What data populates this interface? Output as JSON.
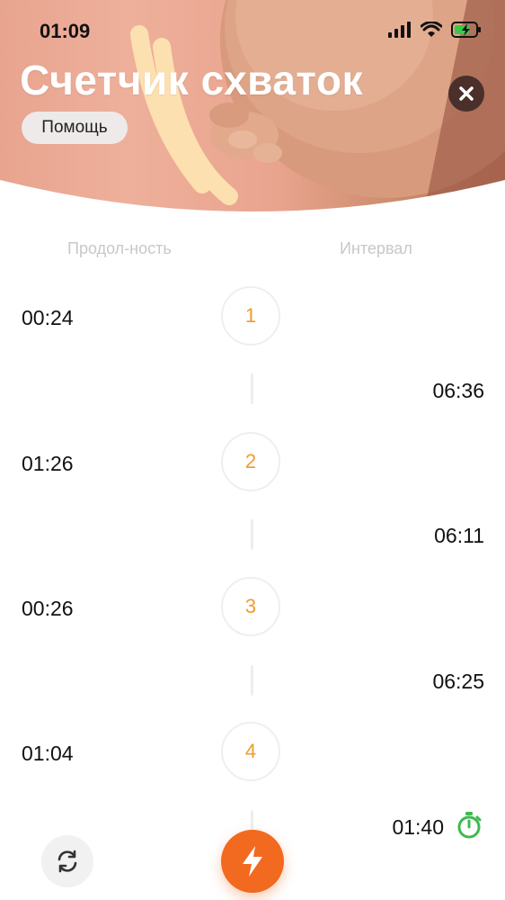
{
  "status_bar": {
    "time": "01:09"
  },
  "header": {
    "title": "Счетчик схваток",
    "help_label": "Помощь"
  },
  "columns": {
    "duration": "Продол-ность",
    "interval": "Интервал"
  },
  "contractions": [
    {
      "number": "1",
      "duration": "00:24"
    },
    {
      "number": "2",
      "duration": "01:26"
    },
    {
      "number": "3",
      "duration": "00:26"
    },
    {
      "number": "4",
      "duration": "01:04"
    }
  ],
  "intervals": [
    "06:36",
    "06:11",
    "06:25"
  ],
  "current_interval": "01:40",
  "colors": {
    "accent": "#f26a1f",
    "number": "#f29a2e",
    "timer": "#3dbb4f"
  },
  "icons": {
    "close": "close-icon",
    "refresh": "refresh-icon",
    "action": "lightning-icon",
    "timer": "stopwatch-icon"
  }
}
